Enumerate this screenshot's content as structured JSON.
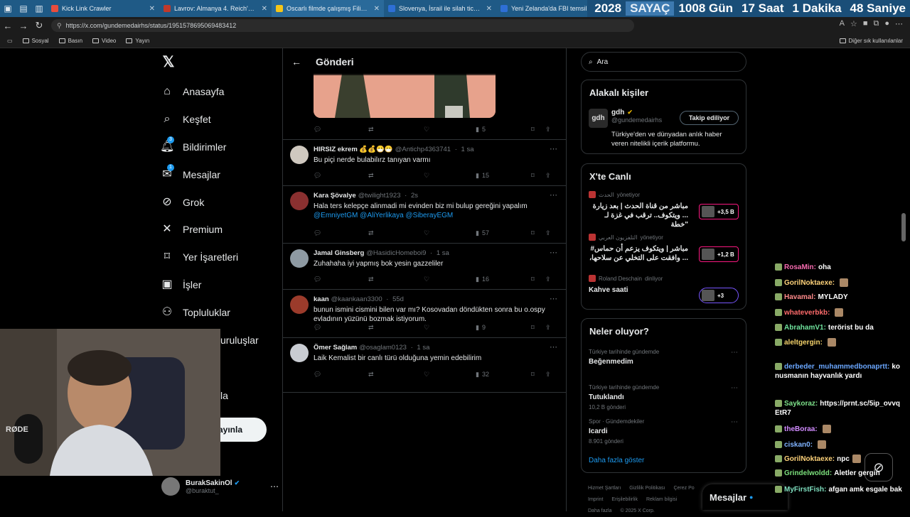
{
  "browser": {
    "tabs": [
      {
        "title": "Kick Link Crawler",
        "color": "#e94d3d",
        "active": false
      },
      {
        "title": "Lavrov: Almanya 4. Reich'a dönü",
        "color": "#c0392b",
        "active": false
      },
      {
        "title": "Oscarlı filmde çalışmış Filistinli",
        "color": "#f5c518",
        "active": true
      },
      {
        "title": "Slovenya, İsrail ile silah ticaretin",
        "color": "#2e6fd6",
        "active": false
      },
      {
        "title": "Yeni Zelanda'da FBI temsilciliği",
        "color": "#2e6fd6",
        "active": false
      }
    ],
    "counter": {
      "year": "2028",
      "label": "SAYAÇ",
      "days": "1008 Gün",
      "hours": "17 Saat",
      "minutes": "1 Dakika",
      "seconds": "48 Saniye"
    },
    "url": "https://x.com/gundemedairhs/status/1951578695069483412",
    "bookmarks": [
      "Sosyal",
      "Basın",
      "Video",
      "Yayın"
    ],
    "other_bookmarks": "Diğer sık kullanılanlar"
  },
  "nav": {
    "items": [
      {
        "label": "Anasayfa",
        "icon": "home-icon"
      },
      {
        "label": "Keşfet",
        "icon": "search-icon"
      },
      {
        "label": "Bildirimler",
        "icon": "bell-icon",
        "badge": "3"
      },
      {
        "label": "Mesajlar",
        "icon": "mail-icon",
        "badge": "1"
      },
      {
        "label": "Grok",
        "icon": "grok-icon"
      },
      {
        "label": "Premium",
        "icon": "x-icon"
      },
      {
        "label": "Yer İşaretleri",
        "icon": "bookmark-icon"
      },
      {
        "label": "İşler",
        "icon": "briefcase-icon"
      },
      {
        "label": "Topluluklar",
        "icon": "people-icon"
      },
      {
        "label": "Kuruluşlar",
        "icon": "lightning-icon"
      },
      {
        "label": "Profil",
        "icon": "user-icon"
      },
      {
        "label": "Daha fazla",
        "icon": "more-icon"
      }
    ],
    "visible_partial": {
      "kuruluslar": "uruluşlar",
      "dahafazla": "la"
    },
    "post_button": "Yayınla",
    "account": {
      "name": "BurakSakinOl",
      "handle": "@buraktut_"
    }
  },
  "column": {
    "title": "Gönderi",
    "top_actions": {
      "views": "5"
    },
    "tweets": [
      {
        "name": "HIRSIZ ekrem 💰💰😷😷",
        "handle": "@Antichp4363741",
        "time": "1 sa",
        "text": "Bu piçi nerde bulabilırz tanıyan varmı",
        "views": "15",
        "avatar": "#cfc8bf"
      },
      {
        "name": "Kara Şövalye",
        "handle": "@twilight1923",
        "time": "2s",
        "text": "Hala ters kelepçe alinmadi mi evinden biz mi bulup gereğini yapalım",
        "links": "@EmniyetGM @AliYerlikaya @SiberayEGM",
        "views": "57",
        "avatar": "#8a3030"
      },
      {
        "name": "Jamal Ginsberg",
        "handle": "@HasidicHomeboi9",
        "time": "1 sa",
        "text": "Zuhahaha iyi yapmış bok yesin gazzeliler",
        "views": "16",
        "avatar": "#8e9aa3"
      },
      {
        "name": "kaan",
        "handle": "@kaankaan3300",
        "time": "55d",
        "text": "bunun ismini cismini bilen var mı? Kosovadan döndükten sonra bu o.ospy evladının yüzünü bozmak istiyorum.",
        "views": "9",
        "avatar": "#9b3b2b"
      },
      {
        "name": "Ömer Sağlam",
        "handle": "@osaglam0123",
        "time": "1 sa",
        "text": "Laik Kemalist bir canlı türü olduğuna yemin edebilirim",
        "views": "32",
        "avatar": "#c9ccd2"
      }
    ]
  },
  "right": {
    "search_placeholder": "Ara",
    "related": {
      "title": "Alakalı kişiler",
      "name": "gdh",
      "handle": "@gundemedairhs",
      "bio": "Türkiye'den ve dünyadan anlık haber veren nitelikli içerik platformu.",
      "follow": "Takip ediliyor",
      "logo": "gdh"
    },
    "live": {
      "title": "X'te Canlı",
      "items": [
        {
          "source": "الحدث",
          "status": "yönetiyor",
          "headline": "مباشر من قناة الحدث | بعد زيارة ... ويتكوف.. ترقب في غزة لـ \"خطة",
          "count": "+3,5 B"
        },
        {
          "source": "التلفزيون العربي",
          "status": "yönetiyor",
          "headline": "مباشر | ويتكوف يزعم أن حماس# ... وافقت على التخلي عن سلاحها،",
          "count": "+1,2 B"
        },
        {
          "source": "Roland Deschain",
          "status": "dinliyor",
          "headline": "Kahve saati",
          "count": "+3"
        }
      ]
    },
    "trends": {
      "title": "Neler oluyor?",
      "items": [
        {
          "context": "Türkiye tarihinde gündemde",
          "name": "Beğenmedim",
          "count": ""
        },
        {
          "context": "Türkiye tarihinde gündemde",
          "name": "Tutuklandı",
          "count": "10,2 B gönderi"
        },
        {
          "context": "Spor · Gündemdekiler",
          "name": "Icardi",
          "count": "8.901 gönderi"
        }
      ],
      "show_more": "Daha fazla göster"
    },
    "footer": [
      "Hizmet Şartları",
      "Gizlilik Politikası",
      "Çerez Po",
      "Imprint",
      "Erişilebilirlik",
      "Reklam bilgisi",
      "Daha fazla",
      "© 2025 X Corp."
    ],
    "messages": "Mesajlar"
  },
  "chat": [
    {
      "user": "RosaMin:",
      "color": "#f76bb0",
      "msg": "oha"
    },
    {
      "user": "GorilNoktaexe:",
      "color": "#ffd37a",
      "msg": ""
    },
    {
      "user": "Havamal:",
      "color": "#ff8a8a",
      "msg": "MYLADY"
    },
    {
      "user": "whateverbkb:",
      "color": "#ff6b6b",
      "msg": ""
    },
    {
      "user": "AbrahamV1:",
      "color": "#6fe39d",
      "msg": "terörist bu da"
    },
    {
      "user": "aleltgergin:",
      "color": "#f5d36b",
      "msg": ""
    },
    {
      "user": "derbeder_muhammedbonaprtt:",
      "color": "#6aa7ff",
      "msg": "konusmanın hayvanlık yardı"
    },
    {
      "user": "Saykoraz:",
      "color": "#7ee28a",
      "msg": "https://prnt.sc/5ip_ovvqEtR7"
    },
    {
      "user": "theBoraa:",
      "color": "#d18bff",
      "msg": ""
    },
    {
      "user": "ciskan0:",
      "color": "#7fb3ff",
      "msg": ""
    },
    {
      "user": "GorilNoktaexe:",
      "color": "#ffd37a",
      "msg": "npc"
    },
    {
      "user": "Grindelwoldd:",
      "color": "#7ce07c",
      "msg": "Aletler gergin"
    },
    {
      "user": "MyFirstFish:",
      "color": "#7fe0c0",
      "msg": "afgan amk esgale bak"
    }
  ]
}
